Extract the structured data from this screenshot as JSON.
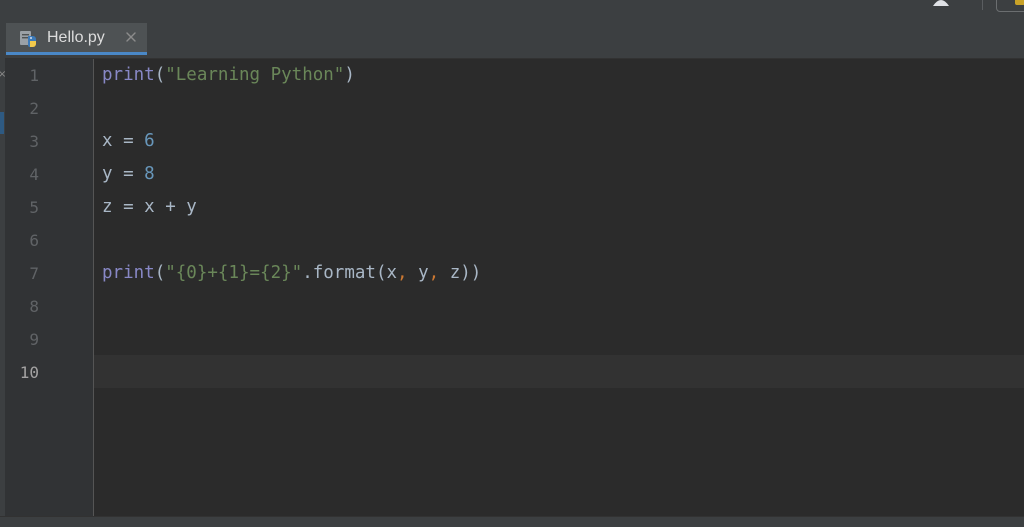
{
  "editor": {
    "tab": {
      "filename": "Hello.py",
      "close_symbol": "✕",
      "icon": "python-file-icon"
    },
    "current_line": 10,
    "lines": [
      {
        "number": "1",
        "tokens": [
          {
            "t": "print",
            "c": "builtin"
          },
          {
            "t": "(",
            "c": "default"
          },
          {
            "t": "\"Learning Python\"",
            "c": "string"
          },
          {
            "t": ")",
            "c": "default"
          }
        ]
      },
      {
        "number": "2",
        "tokens": []
      },
      {
        "number": "3",
        "tokens": [
          {
            "t": "x = ",
            "c": "default"
          },
          {
            "t": "6",
            "c": "number"
          }
        ]
      },
      {
        "number": "4",
        "tokens": [
          {
            "t": "y = ",
            "c": "default"
          },
          {
            "t": "8",
            "c": "number"
          }
        ]
      },
      {
        "number": "5",
        "tokens": [
          {
            "t": "z = x + y",
            "c": "default"
          }
        ]
      },
      {
        "number": "6",
        "tokens": []
      },
      {
        "number": "7",
        "tokens": [
          {
            "t": "print",
            "c": "builtin"
          },
          {
            "t": "(",
            "c": "default"
          },
          {
            "t": "\"{0}+{1}={2}\"",
            "c": "string"
          },
          {
            "t": ".format(x",
            "c": "default"
          },
          {
            "t": ",",
            "c": "comma"
          },
          {
            "t": " y",
            "c": "default"
          },
          {
            "t": ",",
            "c": "comma"
          },
          {
            "t": " z))",
            "c": "default"
          }
        ]
      },
      {
        "number": "8",
        "tokens": []
      },
      {
        "number": "9",
        "tokens": []
      },
      {
        "number": "10",
        "tokens": []
      }
    ]
  },
  "colors": {
    "background": "#2b2b2b",
    "builtin": "#8888c6",
    "string": "#6a8759",
    "number": "#6897bb",
    "comma": "#cc7832",
    "default_text": "#a9b7c6",
    "tab_underline": "#4a88c7"
  }
}
